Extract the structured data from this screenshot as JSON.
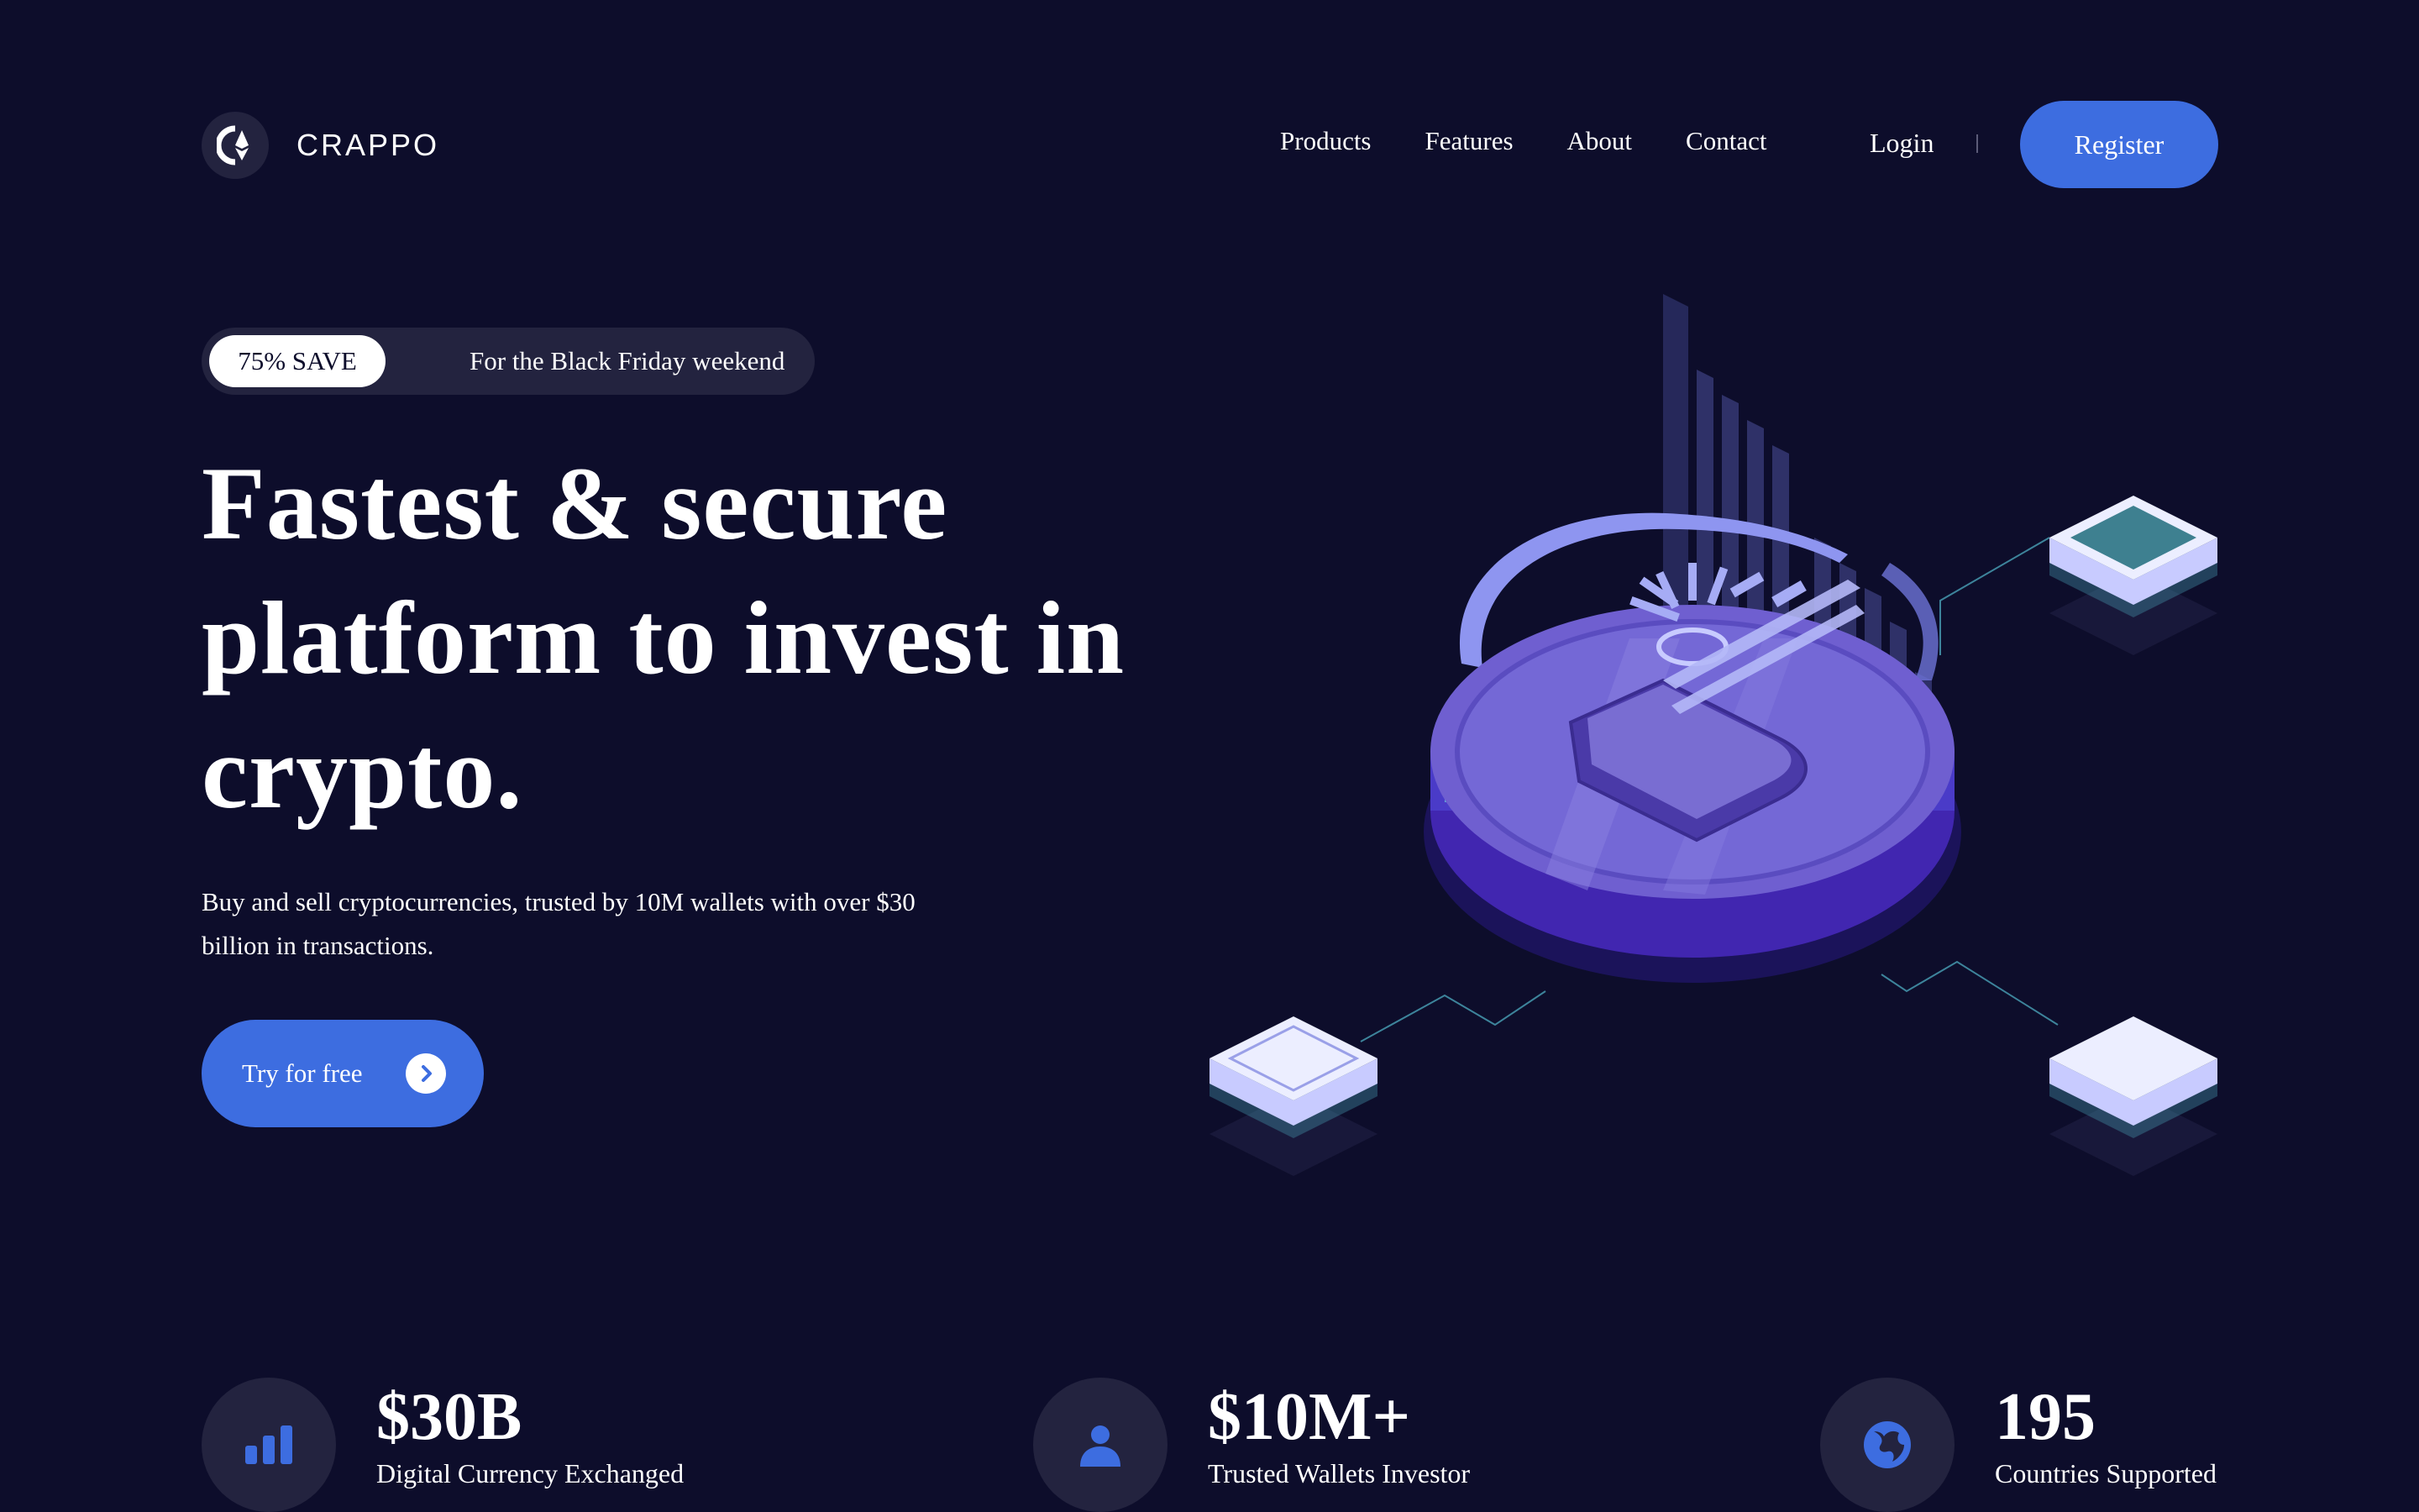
{
  "brand": {
    "name": "CRAPPO",
    "logo_icon": "ethereum-coin-icon"
  },
  "nav": {
    "links": [
      "Products",
      "Features",
      "About",
      "Contact"
    ],
    "login": "Login",
    "register": "Register"
  },
  "hero": {
    "promo_badge": "75% SAVE",
    "promo_text": "For the Black Friday weekend",
    "headline_lines": [
      "Fastest & secure",
      "platform to invest in",
      "crypto."
    ],
    "subtext": "Buy and sell cryptocurrencies, trusted by 10M wallets with over $30 billion in transactions.",
    "cta_label": "Try for free",
    "cta_icon": "chevron-right-circle-icon"
  },
  "stats": [
    {
      "value": "$30B",
      "label": "Digital Currency Exchanged",
      "icon": "bar-chart-icon"
    },
    {
      "value": "$10M+",
      "label": "Trusted Wallets Investor",
      "icon": "user-icon"
    },
    {
      "value": "195",
      "label": "Countries Supported",
      "icon": "globe-icon"
    }
  ],
  "colors": {
    "background": "#0d0d2b",
    "surface": "#23233f",
    "accent": "#3d6de0",
    "text": "#ffffff"
  }
}
